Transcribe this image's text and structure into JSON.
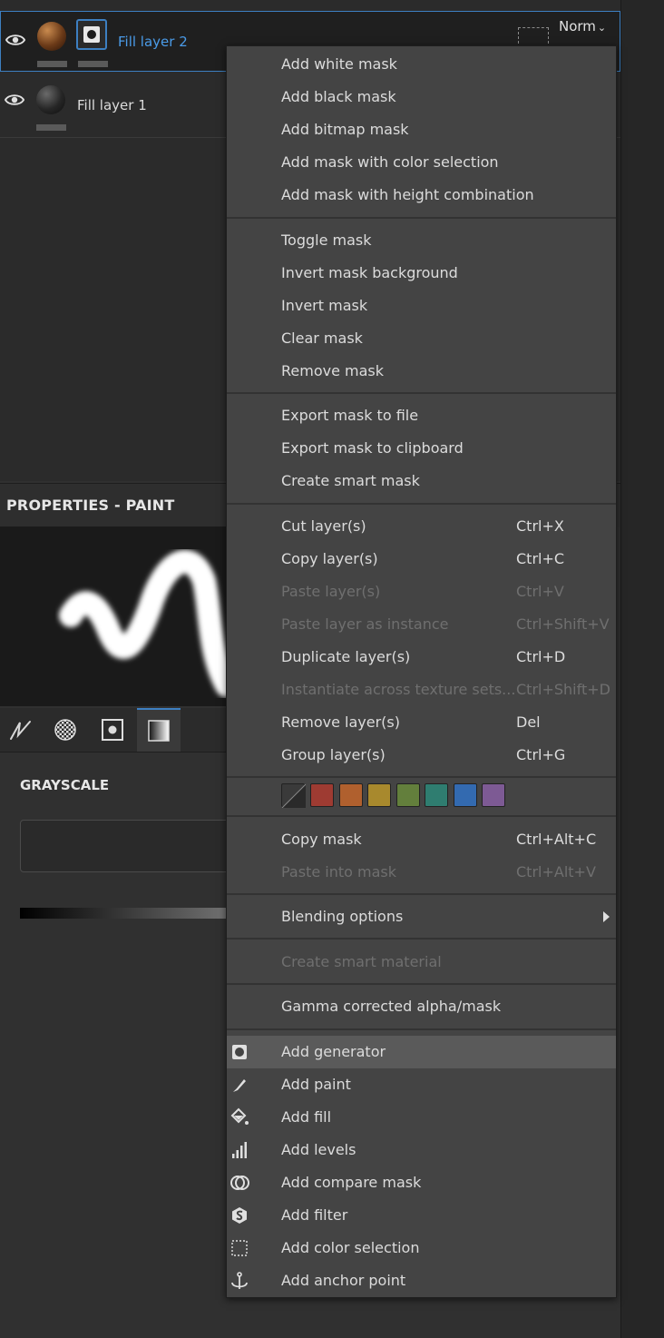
{
  "layers": [
    {
      "name": "Fill layer 2",
      "selected": true
    },
    {
      "name": "Fill layer 1",
      "selected": false
    }
  ],
  "blend_mode": "Norm",
  "properties": {
    "title": "PROPERTIES - PAINT",
    "section_label": "GRAYSCALE"
  },
  "context_menu": {
    "groups": [
      [
        {
          "label": "Add white mask"
        },
        {
          "label": "Add black mask"
        },
        {
          "label": "Add bitmap mask"
        },
        {
          "label": "Add mask with color selection"
        },
        {
          "label": "Add mask with height combination"
        }
      ],
      [
        {
          "label": "Toggle mask"
        },
        {
          "label": "Invert mask background"
        },
        {
          "label": "Invert mask"
        },
        {
          "label": "Clear mask"
        },
        {
          "label": "Remove mask"
        }
      ],
      [
        {
          "label": "Export mask to file"
        },
        {
          "label": "Export mask to clipboard"
        },
        {
          "label": "Create smart mask"
        }
      ],
      [
        {
          "label": "Cut layer(s)",
          "shortcut": "Ctrl+X"
        },
        {
          "label": "Copy layer(s)",
          "shortcut": "Ctrl+C"
        },
        {
          "label": "Paste layer(s)",
          "shortcut": "Ctrl+V",
          "disabled": true
        },
        {
          "label": "Paste layer as instance",
          "shortcut": "Ctrl+Shift+V",
          "disabled": true
        },
        {
          "label": "Duplicate layer(s)",
          "shortcut": "Ctrl+D"
        },
        {
          "label": "Instantiate across texture sets...",
          "shortcut": "Ctrl+Shift+D",
          "disabled": true
        },
        {
          "label": "Remove layer(s)",
          "shortcut": "Del"
        },
        {
          "label": "Group layer(s)",
          "shortcut": "Ctrl+G"
        }
      ],
      [
        {
          "label": "Copy mask",
          "shortcut": "Ctrl+Alt+C"
        },
        {
          "label": "Paste into mask",
          "shortcut": "Ctrl+Alt+V",
          "disabled": true
        }
      ],
      [
        {
          "label": "Blending options"
        }
      ],
      [
        {
          "label": "Create smart material",
          "disabled": true
        }
      ],
      [
        {
          "label": "Gamma corrected alpha/mask"
        }
      ],
      [
        {
          "label": "Add generator",
          "icon": "generator-icon"
        },
        {
          "label": "Add paint",
          "icon": "paint-brush-icon"
        },
        {
          "label": "Add fill",
          "icon": "fill-bucket-icon"
        },
        {
          "label": "Add levels",
          "icon": "levels-icon"
        },
        {
          "label": "Add compare mask",
          "icon": "compare-mask-icon"
        },
        {
          "label": "Add filter",
          "icon": "filter-icon"
        },
        {
          "label": "Add color selection",
          "icon": "color-selection-icon"
        },
        {
          "label": "Add anchor point",
          "icon": "anchor-icon"
        }
      ]
    ],
    "color_swatches": [
      "#9e3b32",
      "#b0602e",
      "#a8892d",
      "#637f3c",
      "#2f7d70",
      "#336ab0",
      "#7d5a94"
    ],
    "hovered": "Add generator"
  }
}
